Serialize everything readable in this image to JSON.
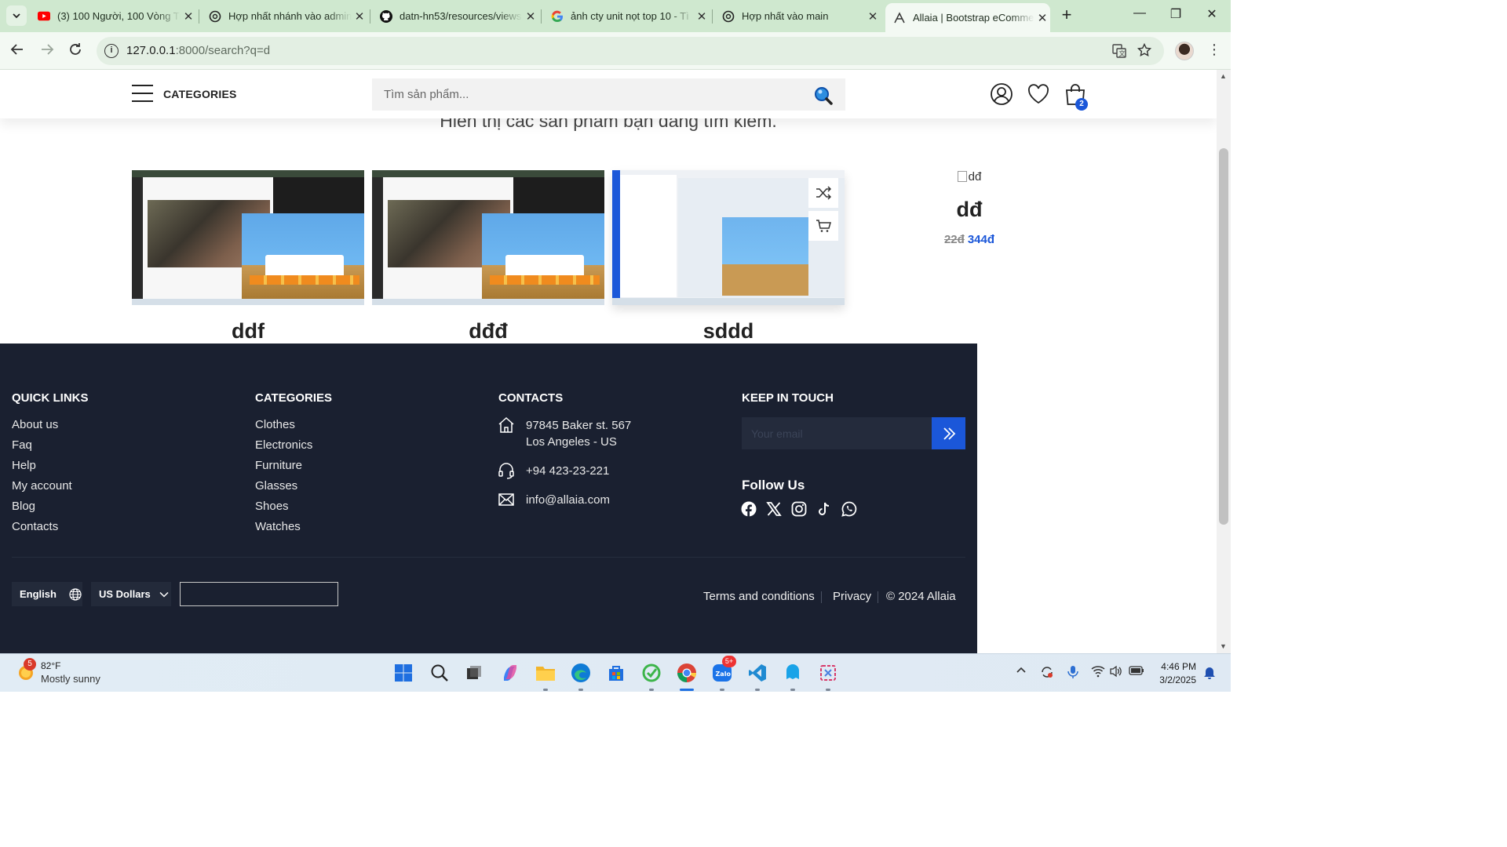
{
  "browser": {
    "tabs": [
      {
        "title": "(3) 100 Người, 100 Vòng Tr",
        "favicon": "youtube-icon"
      },
      {
        "title": "Hợp nhất nhánh vào admin",
        "favicon": "chatgpt-icon"
      },
      {
        "title": "datn-hn53/resources/views",
        "favicon": "github-icon"
      },
      {
        "title": "ảnh cty unit nọt top 10 - Tì",
        "favicon": "google-icon"
      },
      {
        "title": "Hợp nhất vào main",
        "favicon": "chatgpt-icon"
      },
      {
        "title": "Allaia | Bootstrap eComme",
        "favicon": "allaia-icon",
        "active": true
      }
    ],
    "url_host": "127.0.0.1",
    "url_rest": ":8000/search?q=d"
  },
  "header": {
    "categories_label": "CATEGORIES",
    "search_placeholder": "Tìm sản phẩm...",
    "cart_count": "2"
  },
  "results_heading": "Hiển thị các sản phẩm bạn đang tìm kiếm.",
  "products": [
    {
      "name": "ddf",
      "image": "screenshot-thumbnail"
    },
    {
      "name": "dđđ",
      "image": "screenshot-thumbnail"
    },
    {
      "name": "sddd",
      "image": "screenshot-thumbnail"
    },
    {
      "name": "dđ",
      "image_alt": "dđ",
      "old_price": "22đ",
      "new_price": "344đ"
    }
  ],
  "footer": {
    "quick_links": {
      "title": "QUICK LINKS",
      "items": [
        "About us",
        "Faq",
        "Help",
        "My account",
        "Blog",
        "Contacts"
      ]
    },
    "categories": {
      "title": "CATEGORIES",
      "items": [
        "Clothes",
        "Electronics",
        "Furniture",
        "Glasses",
        "Shoes",
        "Watches"
      ]
    },
    "contacts": {
      "title": "CONTACTS",
      "address_line1": "97845 Baker st. 567",
      "address_line2": "Los Angeles - US",
      "phone": "+94 423-23-221",
      "email": "info@allaia.com"
    },
    "keep_in_touch": {
      "title": "KEEP IN TOUCH",
      "email_placeholder": "Your email",
      "follow_us": "Follow Us"
    },
    "language": "English",
    "currency": "US Dollars",
    "legal": {
      "terms": "Terms and conditions",
      "privacy": "Privacy",
      "copyright": "© 2024 Allaia"
    }
  },
  "taskbar": {
    "weather_badge": "5",
    "temperature": "82°F",
    "weather": "Mostly sunny",
    "time": "4:46 PM",
    "date": "3/2/2025",
    "zalo_badge": "5+"
  },
  "colors": {
    "accent": "#1b57d9",
    "footer_bg": "#1a2030",
    "tabstrip_bg": "#cfe8cf"
  }
}
